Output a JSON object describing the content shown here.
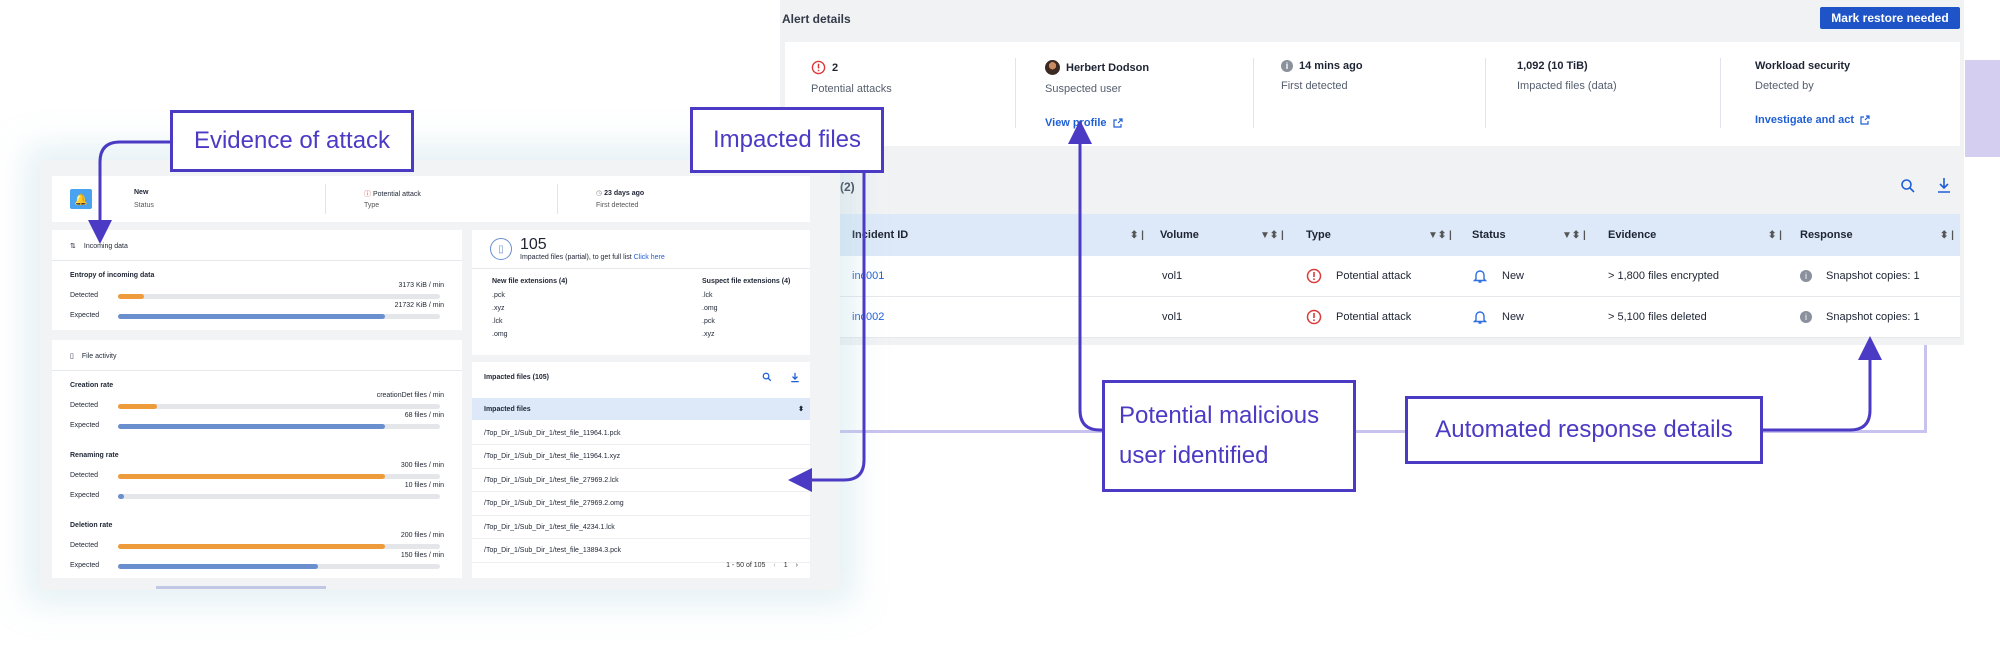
{
  "alert": {
    "title": "Alert details",
    "mark_button": "Mark restore needed",
    "metrics": [
      {
        "value": "2",
        "label": "Potential attacks"
      },
      {
        "value": "Herbert Dodson",
        "label": "Suspected user",
        "action": "View profile"
      },
      {
        "value": "14 mins ago",
        "label": "First detected"
      },
      {
        "value": "1,092 (10 TiB)",
        "label": "Impacted files (data)"
      },
      {
        "value": "Workload security",
        "label": "Detected by",
        "action": "Investigate and act"
      }
    ]
  },
  "incidents": {
    "count": "(2)",
    "columns": [
      "Incident ID",
      "Volume",
      "Type",
      "Status",
      "Evidence",
      "Response"
    ],
    "rows": [
      {
        "id": "inc001",
        "volume": "vol1",
        "type": "Potential attack",
        "status": "New",
        "evidence": "> 1,800 files encrypted",
        "response": "Snapshot copies: 1"
      },
      {
        "id": "inc002",
        "volume": "vol1",
        "type": "Potential attack",
        "status": "New",
        "evidence": "> 5,100 files deleted",
        "response": "Snapshot copies: 1"
      }
    ]
  },
  "left": {
    "summary": [
      {
        "value": "New",
        "label": "Status"
      },
      {
        "value": "Potential attack",
        "label": "Type"
      },
      {
        "value": "23 days ago",
        "label": "First detected"
      }
    ],
    "incoming": {
      "title": "Incoming data",
      "subtitle": "Entropy of incoming data",
      "detected_label": "Detected",
      "expected_label": "Expected",
      "detected_value": "3173 KiB / min",
      "expected_value": "21732 KiB / min",
      "detected_level": 0.08,
      "expected_level": 0.83
    },
    "file_activity": {
      "title": "File activity",
      "groups": [
        {
          "name": "Creation rate",
          "detected": "creationDet files / min",
          "expected": "68 files / min",
          "d": 0.12,
          "e": 0.83
        },
        {
          "name": "Renaming rate",
          "detected": "300 files / min",
          "expected": "10 files / min",
          "d": 0.83,
          "e": 0.02
        },
        {
          "name": "Deletion rate",
          "detected": "200 files / min",
          "expected": "150 files / min",
          "d": 0.83,
          "e": 0.62
        }
      ],
      "detected_label": "Detected",
      "expected_label": "Expected"
    },
    "impacted": {
      "count": "105",
      "desc_prefix": "Impacted files (partial), to get full list",
      "desc_link": "Click here",
      "new_ext_title": "New file extensions (4)",
      "suspect_ext_title": "Suspect file extensions (4)",
      "new_ext": [
        ".pck",
        ".xyz",
        ".lck",
        ".omg"
      ],
      "suspect_ext": [
        ".lck",
        ".omg",
        ".pck",
        ".xyz"
      ],
      "list_title": "Impacted files (105)",
      "list_header": "Impacted files",
      "files": [
        "/Top_Dir_1/Sub_Dir_1/test_file_11964.1.pck",
        "/Top_Dir_1/Sub_Dir_1/test_file_11964.1.xyz",
        "/Top_Dir_1/Sub_Dir_1/test_file_27969.2.lck",
        "/Top_Dir_1/Sub_Dir_1/test_file_27969.2.omg",
        "/Top_Dir_1/Sub_Dir_1/test_file_4234.1.lck",
        "/Top_Dir_1/Sub_Dir_1/test_file_13894.3.pck"
      ],
      "pagination": "1 - 50 of 105",
      "page": "1"
    }
  },
  "callouts": {
    "evidence": "Evidence of attack",
    "impacted": "Impacted files",
    "malicious_1": "Potential malicious",
    "malicious_2": "user identified",
    "automated": "Automated response details"
  },
  "colors": {
    "accent": "#4b3ac4",
    "link": "#1f5fd6",
    "button": "#1e54c8",
    "danger": "#d93b3b"
  }
}
